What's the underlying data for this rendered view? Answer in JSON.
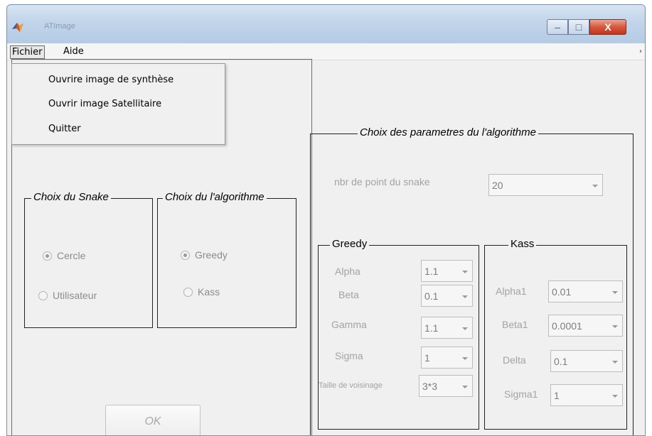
{
  "window": {
    "title": "ATImage",
    "buttons": {
      "minimize": "–",
      "maximize": "□",
      "close": "X"
    }
  },
  "menubar": {
    "items": [
      {
        "label": "Fichier"
      },
      {
        "label": "Aide"
      }
    ],
    "overflow": "›"
  },
  "fichier_menu": {
    "items": [
      {
        "label": "Ouvrire image de synthèse"
      },
      {
        "label": "Ouvrir image Satellitaire"
      },
      {
        "label": "Quitter"
      }
    ]
  },
  "snake_group": {
    "title": "Choix du Snake",
    "options": [
      {
        "label": "Cercle",
        "checked": true
      },
      {
        "label": "Utilisateur",
        "checked": false
      }
    ]
  },
  "algo_group": {
    "title": "Choix du l'algorithme",
    "options": [
      {
        "label": "Greedy",
        "checked": true
      },
      {
        "label": "Kass",
        "checked": false
      }
    ]
  },
  "params_group": {
    "title": "Choix des parametres du l'algorithme",
    "nbr_points_label": "nbr de point du snake",
    "nbr_points_value": "20"
  },
  "greedy_group": {
    "title": "Greedy",
    "fields": [
      {
        "label": "Alpha",
        "value": "1.1"
      },
      {
        "label": "Beta",
        "value": "0.1"
      },
      {
        "label": "Gamma",
        "value": "1.1"
      },
      {
        "label": "Sigma",
        "value": "1"
      },
      {
        "label": "Taille de voisinage",
        "value": "3*3"
      }
    ]
  },
  "kass_group": {
    "title": "Kass",
    "fields": [
      {
        "label": "Alpha1",
        "value": "0.01"
      },
      {
        "label": "Beta1",
        "value": "0.0001"
      },
      {
        "label": "Delta",
        "value": "0.1"
      },
      {
        "label": "Sigma1",
        "value": "1"
      }
    ]
  },
  "ok_button": {
    "label": "OK"
  },
  "colors": {
    "window_bg": "#f0f0f0",
    "disabled_text": "#a3a3a3",
    "close_button": "#c3361b",
    "titlebar": "#c1d4ea"
  }
}
